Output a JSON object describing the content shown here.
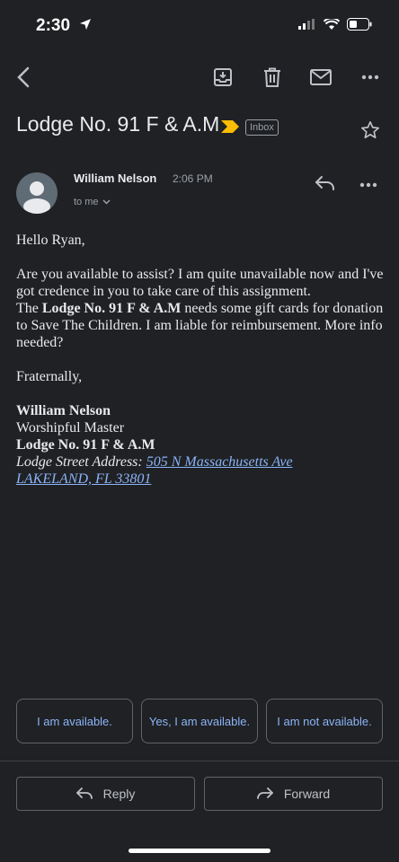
{
  "status_bar": {
    "time": "2:30"
  },
  "subject": {
    "title": "Lodge No. 91 F & A.M",
    "label": "Inbox"
  },
  "sender": {
    "name": "William Nelson",
    "time": "2:06 PM",
    "to": "to me"
  },
  "body": {
    "greeting": "Hello Ryan,",
    "p1": "Are you available to assist? I am quite unavailable now and I've got credence in you to take care of this assignment.",
    "p2_prefix": "The ",
    "p2_lodge": "Lodge No. 91 F & A.M",
    "p2_rest": " needs some gift cards for donation to Save The Children. I am liable for reimbursement. More info needed?",
    "closing": "Fraternally,",
    "sig_name": "William Nelson",
    "sig_title": "Worshipful Master",
    "sig_lodge": "Lodge No. 91 F & A.M",
    "address_label": "Lodge Street Address:",
    "address_line1": "505 N Massachusetts Ave",
    "address_line2": "LAKELAND, FL 33801"
  },
  "smart_replies": [
    "I am available.",
    "Yes, I am available.",
    "I am not available."
  ],
  "actions": {
    "reply": "Reply",
    "forward": "Forward"
  },
  "colors": {
    "background": "#202124",
    "link": "#8ab4f8",
    "important": "#fbbc04"
  }
}
